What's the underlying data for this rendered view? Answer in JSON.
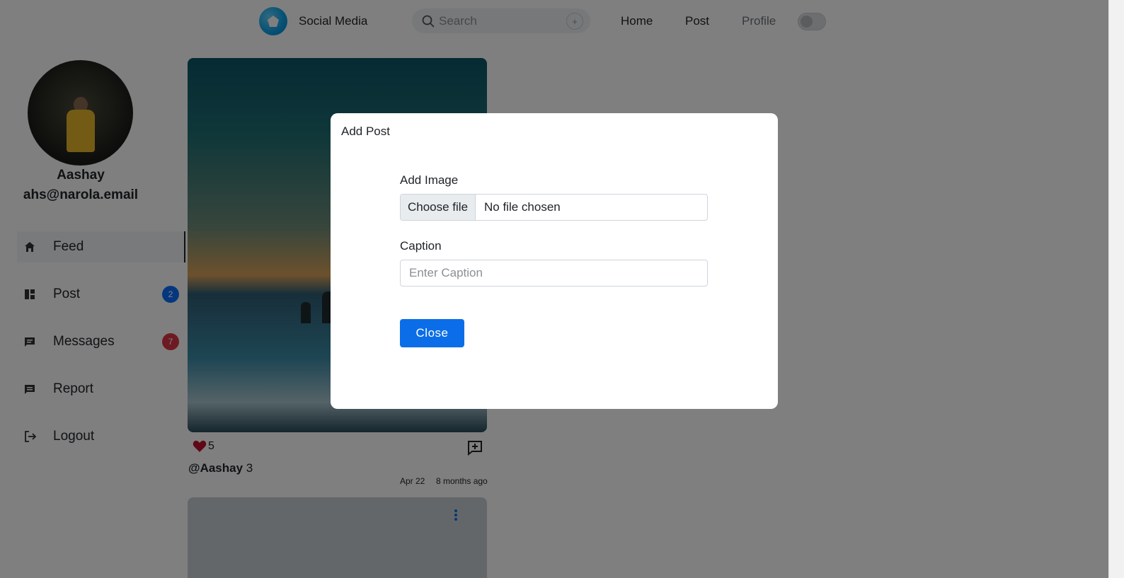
{
  "navbar": {
    "brand_name": "Social Media",
    "search_placeholder": "Search",
    "search_add": "+",
    "links": [
      "Home",
      "Post",
      "Profile"
    ]
  },
  "sidebar": {
    "profile_name": "Aashay",
    "profile_email": "ahs@narola.email",
    "items": [
      {
        "label": "Feed",
        "icon": "home-icon"
      },
      {
        "label": "Post",
        "icon": "dashboard-icon",
        "badge": "2"
      },
      {
        "label": "Messages",
        "icon": "message-icon",
        "badge": "7"
      },
      {
        "label": "Report",
        "icon": "report-icon"
      },
      {
        "label": "Logout",
        "icon": "logout-icon"
      }
    ]
  },
  "feed": {
    "post": {
      "likes": "5",
      "author": "@Aashay",
      "caption": "3",
      "date": "Apr 22",
      "ago": "8 months ago"
    }
  },
  "modal": {
    "title": "Add Post",
    "image_label": "Add Image",
    "file_button": "Choose file",
    "file_status": "No file chosen",
    "caption_label": "Caption",
    "caption_placeholder": "Enter Caption",
    "close_label": "Close"
  },
  "colors": {
    "primary": "#0b6ee8",
    "badge_blue": "#0d6efd",
    "badge_red": "#dc3545",
    "heart": "#c0102a"
  }
}
